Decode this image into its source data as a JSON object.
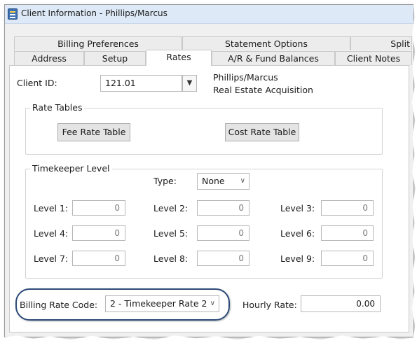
{
  "window": {
    "title": "Client Information - Phillips/Marcus"
  },
  "tabs_row1": [
    "Billing Preferences",
    "Statement Options",
    "Split"
  ],
  "tabs_row2": [
    "Address",
    "Setup",
    "Rates",
    "A/R & Fund Balances",
    "Client Notes"
  ],
  "active_tab": "Rates",
  "client": {
    "id_label": "Client ID:",
    "id_value": "121.01",
    "name": "Phillips/Marcus",
    "matter": "Real Estate Acquisition"
  },
  "rate_tables": {
    "title": "Rate Tables",
    "fee_button": "Fee Rate Table",
    "cost_button": "Cost Rate Table"
  },
  "timekeeper": {
    "title": "Timekeeper Level",
    "type_label": "Type:",
    "type_value": "None",
    "levels": [
      {
        "label": "Level 1:",
        "value": "0"
      },
      {
        "label": "Level 2:",
        "value": "0"
      },
      {
        "label": "Level 3:",
        "value": "0"
      },
      {
        "label": "Level 4:",
        "value": "0"
      },
      {
        "label": "Level 5:",
        "value": "0"
      },
      {
        "label": "Level 6:",
        "value": "0"
      },
      {
        "label": "Level 7:",
        "value": "0"
      },
      {
        "label": "Level 8:",
        "value": "0"
      },
      {
        "label": "Level 9:",
        "value": "0"
      }
    ]
  },
  "billing": {
    "rate_code_label": "Billing Rate Code:",
    "rate_code_value": "2 - Timekeeper Rate 2",
    "hourly_rate_label": "Hourly Rate:",
    "hourly_rate_value": "0.00"
  },
  "icons": {
    "app": "client-info-app-icon",
    "dropdown": "chevron-down-icon"
  },
  "colors": {
    "highlight_ring": "#2c4a78",
    "titlebar": "#dde9f6"
  }
}
